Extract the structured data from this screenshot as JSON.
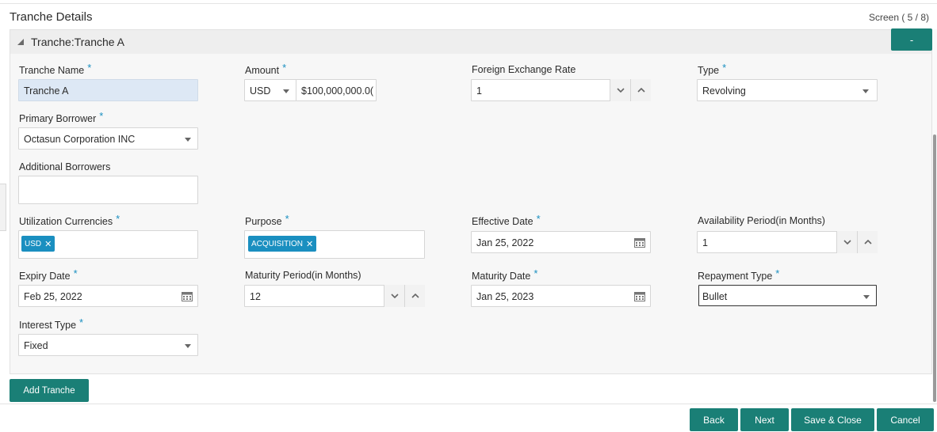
{
  "header": {
    "title": "Tranche Details",
    "screen": "Screen ( 5 / 8)"
  },
  "panel": {
    "title": "Tranche:Tranche A",
    "collapse_label": "-"
  },
  "fields": {
    "tranche_name": {
      "label": "Tranche Name",
      "value": "Tranche A",
      "required": "*"
    },
    "amount": {
      "label": "Amount",
      "currency": "USD",
      "value": "$100,000,000.0(",
      "required": "*"
    },
    "fx_rate": {
      "label": "Foreign Exchange Rate",
      "value": "1"
    },
    "type": {
      "label": "Type",
      "value": "Revolving",
      "required": "*"
    },
    "primary_borrower": {
      "label": "Primary Borrower",
      "value": "Octasun Corporation INC",
      "required": "*"
    },
    "additional_borrowers": {
      "label": "Additional Borrowers",
      "value": ""
    },
    "utilization_currencies": {
      "label": "Utilization Currencies",
      "chips": [
        "USD"
      ],
      "required": "*"
    },
    "purpose": {
      "label": "Purpose",
      "chips": [
        "ACQUISITION"
      ],
      "required": "*"
    },
    "effective_date": {
      "label": "Effective Date",
      "value": "Jan 25, 2022",
      "required": "*"
    },
    "availability_period": {
      "label": "Availability Period(in Months)",
      "value": "1"
    },
    "expiry_date": {
      "label": "Expiry Date",
      "value": "Feb 25, 2022",
      "required": "*"
    },
    "maturity_period": {
      "label": "Maturity Period(in Months)",
      "value": "12"
    },
    "maturity_date": {
      "label": "Maturity Date",
      "value": "Jan 25, 2023",
      "required": "*"
    },
    "repayment_type": {
      "label": "Repayment Type",
      "value": "Bullet",
      "required": "*"
    },
    "interest_type": {
      "label": "Interest Type",
      "value": "Fixed",
      "required": "*"
    }
  },
  "actions": {
    "add_tranche": "Add Tranche",
    "back": "Back",
    "next": "Next",
    "save_close": "Save & Close",
    "cancel": "Cancel"
  },
  "colors": {
    "primary_button": "#1a7f76",
    "chip": "#1a8fc0",
    "required_star": "#1a8fc0"
  }
}
